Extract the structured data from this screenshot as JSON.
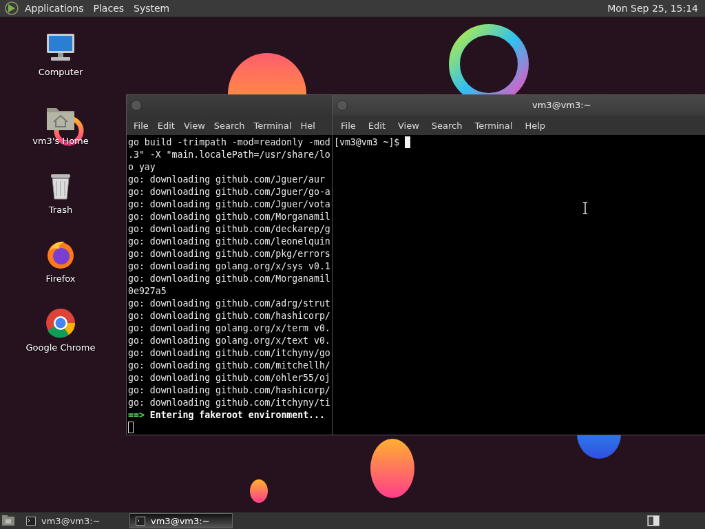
{
  "top_panel": {
    "menus": [
      "Applications",
      "Places",
      "System"
    ],
    "clock": "Mon Sep 25, 15:14"
  },
  "desktop_icons": [
    {
      "label": "Computer",
      "kind": "computer"
    },
    {
      "label": "vm3's Home",
      "kind": "home"
    },
    {
      "label": "Trash",
      "kind": "trash"
    },
    {
      "label": "Firefox",
      "kind": "firefox"
    },
    {
      "label": "Google Chrome",
      "kind": "chrome"
    }
  ],
  "windows": [
    {
      "focused": false,
      "menus": [
        "File",
        "Edit",
        "View",
        "Search",
        "Terminal",
        "Hel"
      ],
      "lines": [
        {
          "kind": "plain",
          "text": "go build -trimpath -mod=readonly -mod"
        },
        {
          "kind": "plain",
          "text": ".3\" -X \"main.localePath=/usr/share/lo"
        },
        {
          "kind": "plain",
          "text": "o yay"
        },
        {
          "kind": "plain",
          "text": "go: downloading github.com/Jguer/aur"
        },
        {
          "kind": "plain",
          "text": "go: downloading github.com/Jguer/go-a"
        },
        {
          "kind": "plain",
          "text": "go: downloading github.com/Jguer/vota"
        },
        {
          "kind": "plain",
          "text": "go: downloading github.com/Morganamil"
        },
        {
          "kind": "plain",
          "text": "go: downloading github.com/deckarep/g"
        },
        {
          "kind": "plain",
          "text": "go: downloading github.com/leonelquin"
        },
        {
          "kind": "plain",
          "text": "go: downloading github.com/pkg/errors"
        },
        {
          "kind": "plain",
          "text": "go: downloading golang.org/x/sys v0.1"
        },
        {
          "kind": "plain",
          "text": "go: downloading github.com/Morganamil"
        },
        {
          "kind": "plain",
          "text": "0e927a5"
        },
        {
          "kind": "plain",
          "text": "go: downloading github.com/adrg/strut"
        },
        {
          "kind": "plain",
          "text": "go: downloading github.com/hashicorp/"
        },
        {
          "kind": "plain",
          "text": "go: downloading golang.org/x/term v0."
        },
        {
          "kind": "plain",
          "text": "go: downloading golang.org/x/text v0."
        },
        {
          "kind": "plain",
          "text": "go: downloading github.com/itchyny/go"
        },
        {
          "kind": "plain",
          "text": "go: downloading github.com/mitchellh/"
        },
        {
          "kind": "plain",
          "text": "go: downloading github.com/ohler55/oj"
        },
        {
          "kind": "plain",
          "text": "go: downloading github.com/hashicorp/"
        },
        {
          "kind": "plain",
          "text": "go: downloading github.com/itchyny/ti"
        },
        {
          "kind": "status",
          "marker": "==>",
          "text": "Entering fakeroot environment..."
        },
        {
          "kind": "cursor"
        }
      ]
    },
    {
      "focused": true,
      "title": "vm3@vm3:~",
      "menus": [
        "File",
        "Edit",
        "View",
        "Search",
        "Terminal",
        "Help"
      ],
      "lines": [
        {
          "kind": "prompt",
          "text": "[vm3@vm3 ~]$"
        }
      ]
    }
  ],
  "taskbar": {
    "items": [
      {
        "label": "vm3@vm3:~",
        "selected": false
      },
      {
        "label": "vm3@vm3:~",
        "selected": true
      }
    ]
  }
}
